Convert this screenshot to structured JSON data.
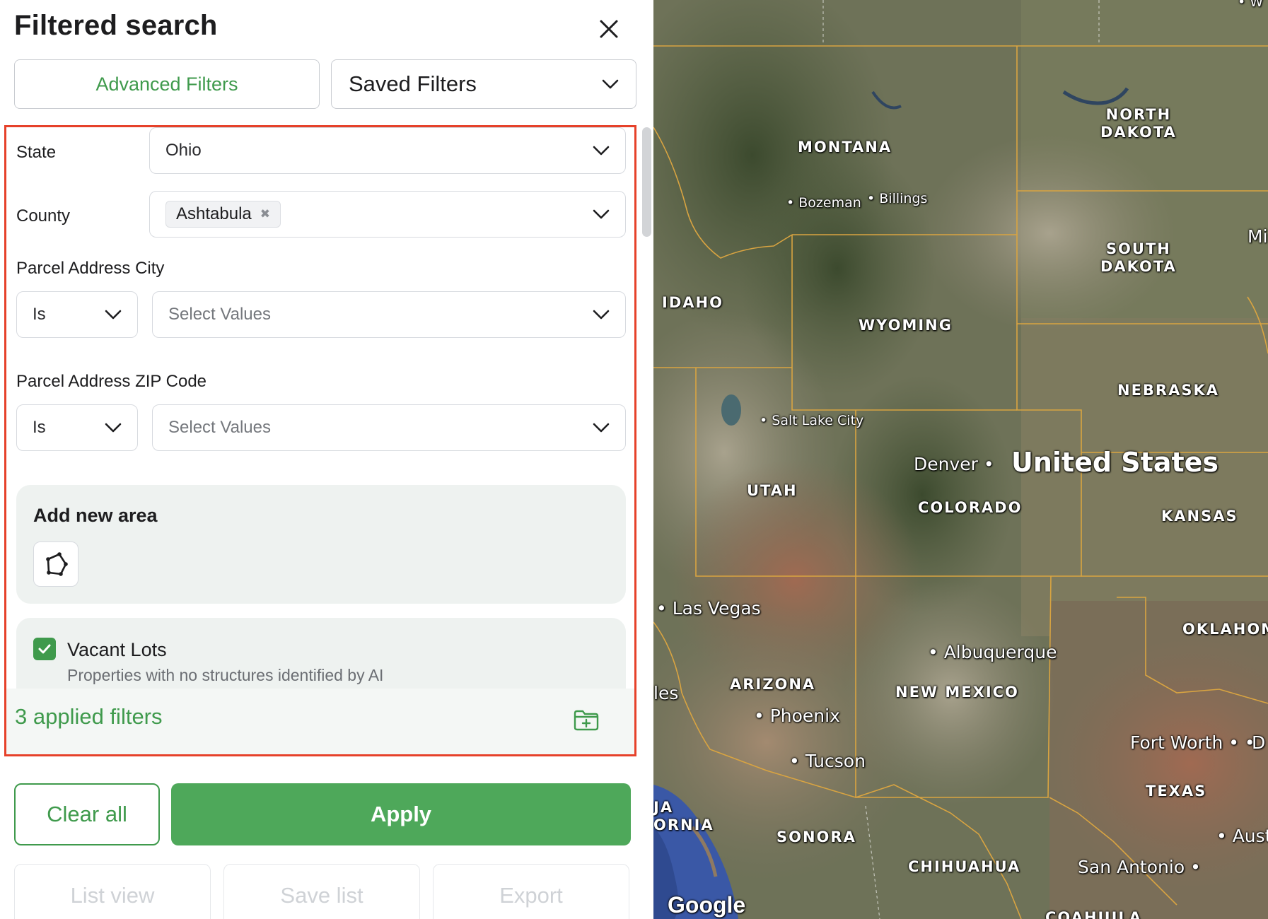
{
  "panel": {
    "title": "Filtered search",
    "tabs": {
      "advanced": "Advanced Filters",
      "saved": "Saved Filters"
    },
    "filters": {
      "state": {
        "label": "State",
        "value": "Ohio"
      },
      "county": {
        "label": "County",
        "chip": "Ashtabula"
      },
      "city": {
        "label": "Parcel Address City",
        "operator": "Is",
        "placeholder": "Select Values"
      },
      "zip": {
        "label": "Parcel Address ZIP Code",
        "operator": "Is",
        "placeholder": "Select Values"
      }
    },
    "area": {
      "title": "Add new area"
    },
    "vacant": {
      "label": "Vacant Lots",
      "description": "Properties with no structures identified by AI",
      "checked": true
    },
    "applied": "3 applied filters",
    "buttons": {
      "clear": "Clear all",
      "apply": "Apply",
      "list_view": "List view",
      "save_list": "Save list",
      "export": "Export"
    }
  },
  "map": {
    "country": "United States",
    "states": [
      "MONTANA",
      "NORTH DAKOTA",
      "SOUTH DAKOTA",
      "IDAHO",
      "WYOMING",
      "NEBRASKA",
      "UTAH",
      "COLORADO",
      "KANSAS",
      "OKLAHOMA",
      "ARIZONA",
      "NEW MEXICO",
      "TEXAS",
      "SONORA",
      "CHIHUAHUA",
      "COAHUILA",
      "BAJA CALIFORNIA"
    ],
    "state_parts": {
      "north_dakota_1": "NORTH",
      "north_dakota_2": "DAKOTA",
      "south_dakota_1": "SOUTH",
      "south_dakota_2": "DAKOTA",
      "baja_1": "JA",
      "baja_2": "ORNIA",
      "oklahoma_cut": "OKLAHOM",
      "coahuila_cut": "COAHUILA",
      "mi_cut": "Mi"
    },
    "cities": [
      "Bozeman",
      "Billings",
      "Salt Lake City",
      "Denver",
      "Las Vegas",
      "Albuquerque",
      "Phoenix",
      "Tucson",
      "Fort Worth",
      "San Antonio"
    ],
    "city_cuts": {
      "les": "les",
      "aust": "Aust",
      "d": "D",
      "w": "W"
    },
    "attribution": "Google",
    "colors": {
      "border": "#d9a441",
      "terrain_dark": "#4d5a3c",
      "water": "#3a58a6",
      "desert": "#a58a6c"
    }
  }
}
